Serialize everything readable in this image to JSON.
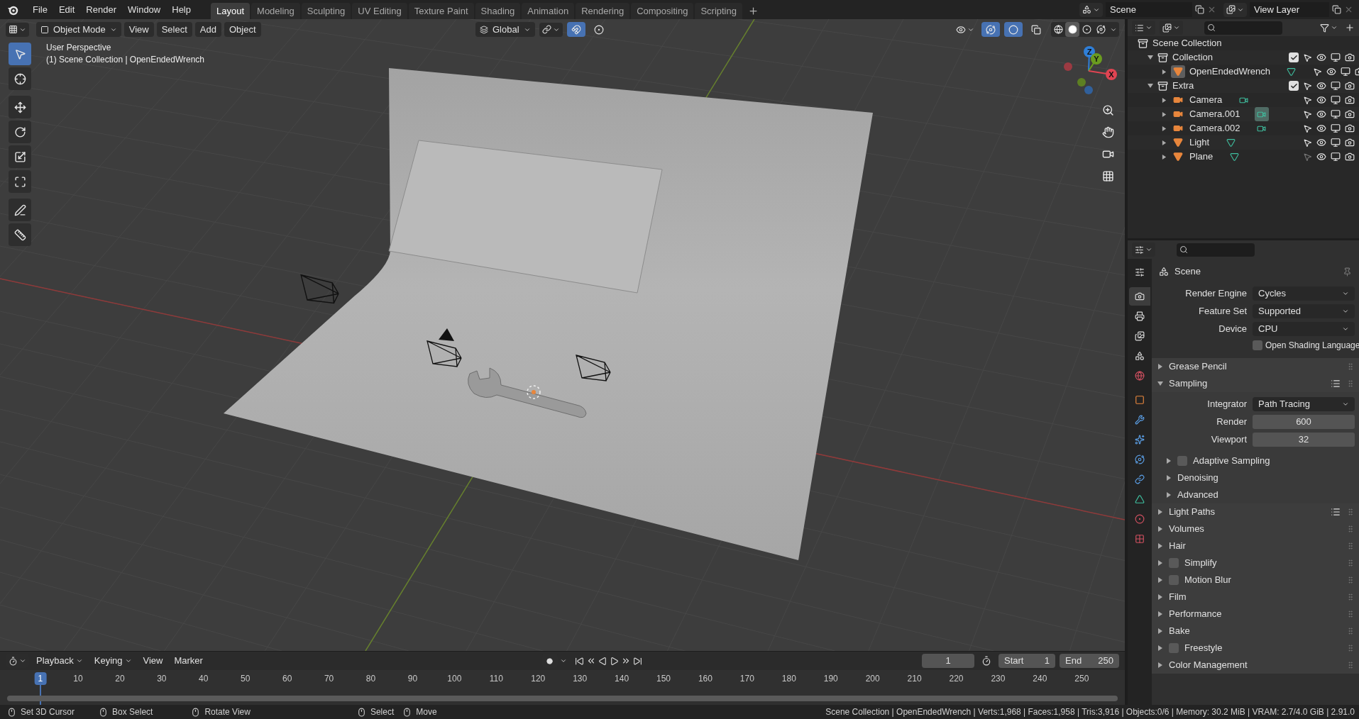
{
  "topbar": {
    "menus": [
      "File",
      "Edit",
      "Render",
      "Window",
      "Help"
    ],
    "workspaces": [
      {
        "label": "Layout",
        "selected": true
      },
      {
        "label": "Modeling",
        "selected": false
      },
      {
        "label": "Sculpting",
        "selected": false
      },
      {
        "label": "UV Editing",
        "selected": false
      },
      {
        "label": "Texture Paint",
        "selected": false
      },
      {
        "label": "Shading",
        "selected": false
      },
      {
        "label": "Animation",
        "selected": false
      },
      {
        "label": "Rendering",
        "selected": false
      },
      {
        "label": "Compositing",
        "selected": false
      },
      {
        "label": "Scripting",
        "selected": false
      }
    ],
    "scene": "Scene",
    "view_layer": "View Layer"
  },
  "viewport": {
    "mode": "Object Mode",
    "menus": [
      "View",
      "Select",
      "Add",
      "Object"
    ],
    "orientation": "Global",
    "toggles": [
      {
        "kind": "snap",
        "on": true
      },
      {
        "kind": "proportional",
        "on": false
      },
      {
        "kind": "gizmos",
        "on": true
      },
      {
        "kind": "overlays",
        "on": true
      },
      {
        "kind": "xray",
        "on": false
      }
    ],
    "shading": [
      {
        "kind": "wireframe",
        "selected": false
      },
      {
        "kind": "solid",
        "selected": true
      },
      {
        "kind": "material",
        "selected": false
      },
      {
        "kind": "rendered",
        "selected": false
      }
    ],
    "info": [
      "User Perspective",
      "(1) Scene Collection | OpenEndedWrench"
    ],
    "tools": [
      {
        "kind": "select",
        "selected": true
      },
      {
        "kind": "cursor",
        "selected": false
      },
      {
        "kind": "move",
        "selected": false
      },
      {
        "kind": "rotate",
        "selected": false
      },
      {
        "kind": "scale",
        "selected": false
      },
      {
        "kind": "transform",
        "selected": false
      },
      {
        "kind": "annotate",
        "selected": false
      },
      {
        "kind": "measure",
        "selected": false
      }
    ],
    "axes": [
      {
        "label": "Z",
        "color": "#2f7fd8"
      },
      {
        "label": "Y",
        "color": "#6b9c1f"
      },
      {
        "label": "X",
        "color": "#e04452"
      }
    ]
  },
  "outliner": {
    "root": "Scene Collection",
    "items": [
      {
        "kind": "collection",
        "name": "Collection",
        "expanded": true,
        "checked": true,
        "selectable": true,
        "children": [
          {
            "kind": "mesh",
            "name": "OpenEndedWrench",
            "active": true,
            "data_active": false,
            "selectable": true
          }
        ]
      },
      {
        "kind": "collection",
        "name": "Extra",
        "expanded": true,
        "checked": true,
        "selectable": true,
        "children": [
          {
            "kind": "camera",
            "name": "Camera",
            "active": false,
            "data_active": false,
            "selectable": true
          },
          {
            "kind": "camera",
            "name": "Camera.001",
            "active": false,
            "data_active": true,
            "selectable": true
          },
          {
            "kind": "camera",
            "name": "Camera.002",
            "active": false,
            "data_active": false,
            "selectable": true
          },
          {
            "kind": "mesh",
            "name": "Light",
            "active": false,
            "data_active": false,
            "selectable": true
          },
          {
            "kind": "mesh",
            "name": "Plane",
            "active": false,
            "data_active": false,
            "selectable": false
          }
        ]
      }
    ]
  },
  "properties": {
    "tabs": [
      {
        "kind": "tool",
        "selected": false
      },
      {
        "kind": "render",
        "selected": true
      },
      {
        "kind": "output",
        "selected": false
      },
      {
        "kind": "view_layer",
        "selected": false
      },
      {
        "kind": "scene",
        "selected": false
      },
      {
        "kind": "world",
        "selected": false
      },
      {
        "kind": "object",
        "selected": false
      },
      {
        "kind": "modifiers",
        "selected": false
      },
      {
        "kind": "particles",
        "selected": false
      },
      {
        "kind": "physics",
        "selected": false
      },
      {
        "kind": "constraints",
        "selected": false
      },
      {
        "kind": "data",
        "selected": false
      },
      {
        "kind": "material",
        "selected": false
      },
      {
        "kind": "texture",
        "selected": false
      }
    ],
    "context": "Scene",
    "fields": [
      {
        "label": "Render Engine",
        "value": "Cycles"
      },
      {
        "label": "Feature Set",
        "value": "Supported"
      },
      {
        "label": "Device",
        "value": "CPU"
      }
    ],
    "options": [
      {
        "label": "Open Shading Language",
        "checked": false
      }
    ],
    "panels": [
      {
        "title": "Grease Pencil",
        "expanded": false,
        "presets": false
      },
      {
        "title": "Sampling",
        "expanded": true,
        "presets": true,
        "fields": [
          {
            "kind": "dropdown",
            "label": "Integrator",
            "value": "Path Tracing"
          },
          {
            "kind": "number",
            "label": "Render",
            "value": "600"
          },
          {
            "kind": "number",
            "label": "Viewport",
            "value": "32"
          }
        ],
        "subpanels": [
          {
            "title": "Adaptive Sampling",
            "expanded": false,
            "checked": false
          },
          {
            "title": "Denoising",
            "expanded": false
          },
          {
            "title": "Advanced",
            "expanded": false
          }
        ]
      },
      {
        "title": "Light Paths",
        "expanded": false,
        "presets": true
      },
      {
        "title": "Volumes",
        "expanded": false,
        "presets": false
      },
      {
        "title": "Hair",
        "expanded": false,
        "presets": false
      },
      {
        "title": "Simplify",
        "expanded": false,
        "presets": false,
        "checked": false
      },
      {
        "title": "Motion Blur",
        "expanded": false,
        "presets": false,
        "checked": false
      },
      {
        "title": "Film",
        "expanded": false,
        "presets": false
      },
      {
        "title": "Performance",
        "expanded": false,
        "presets": false
      },
      {
        "title": "Bake",
        "expanded": false,
        "presets": false
      },
      {
        "title": "Freestyle",
        "expanded": false,
        "presets": false,
        "checked": false
      },
      {
        "title": "Color Management",
        "expanded": false,
        "presets": false
      }
    ]
  },
  "timeline": {
    "menus": [
      "Playback",
      "Keying",
      "View",
      "Marker"
    ],
    "current_frame": "1",
    "start_label": "Start",
    "start": "1",
    "end_label": "End",
    "end": "250",
    "ruler": [
      {
        "label": "1",
        "selected": true
      },
      {
        "label": "10",
        "selected": false
      },
      {
        "label": "20",
        "selected": false
      },
      {
        "label": "30",
        "selected": false
      },
      {
        "label": "40",
        "selected": false
      },
      {
        "label": "50",
        "selected": false
      },
      {
        "label": "60",
        "selected": false
      },
      {
        "label": "70",
        "selected": false
      },
      {
        "label": "80",
        "selected": false
      },
      {
        "label": "90",
        "selected": false
      },
      {
        "label": "100",
        "selected": false
      },
      {
        "label": "110",
        "selected": false
      },
      {
        "label": "120",
        "selected": false
      },
      {
        "label": "130",
        "selected": false
      },
      {
        "label": "140",
        "selected": false
      },
      {
        "label": "150",
        "selected": false
      },
      {
        "label": "160",
        "selected": false
      },
      {
        "label": "170",
        "selected": false
      },
      {
        "label": "180",
        "selected": false
      },
      {
        "label": "190",
        "selected": false
      },
      {
        "label": "200",
        "selected": false
      },
      {
        "label": "210",
        "selected": false
      },
      {
        "label": "220",
        "selected": false
      },
      {
        "label": "230",
        "selected": false
      },
      {
        "label": "240",
        "selected": false
      },
      {
        "label": "250",
        "selected": false
      }
    ]
  },
  "status_bar": {
    "hints": [
      "Set 3D Cursor",
      "Box Select",
      "Rotate View",
      "Select",
      "Move"
    ],
    "stats": "Scene Collection | OpenEndedWrench | Verts:1,968 | Faces:1,958 | Tris:3,916 | Objects:0/6 | Memory: 30.2 MiB | VRAM: 2.7/4.0 GiB | 2.91.0"
  }
}
